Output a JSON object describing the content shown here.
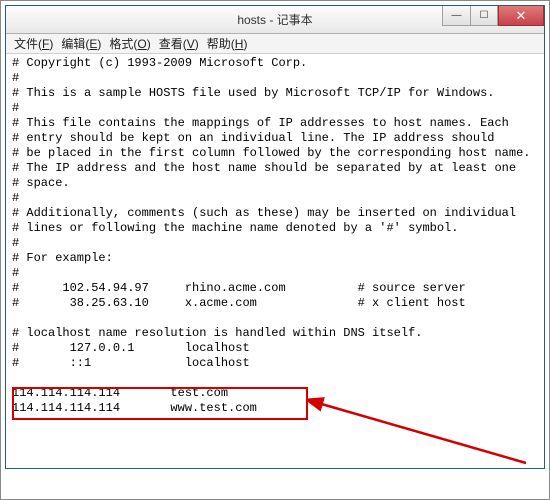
{
  "window": {
    "title": "hosts - 记事本",
    "controls": {
      "min": "—",
      "max": "☐",
      "close": "✕"
    }
  },
  "menu": {
    "file": {
      "label": "文件",
      "key": "F"
    },
    "edit": {
      "label": "编辑",
      "key": "E"
    },
    "format": {
      "label": "格式",
      "key": "O"
    },
    "view": {
      "label": "查看",
      "key": "V"
    },
    "help": {
      "label": "帮助",
      "key": "H"
    }
  },
  "lines": {
    "l0": "# Copyright (c) 1993-2009 Microsoft Corp.",
    "l1": "#",
    "l2": "# This is a sample HOSTS file used by Microsoft TCP/IP for Windows.",
    "l3": "#",
    "l4": "# This file contains the mappings of IP addresses to host names. Each",
    "l5": "# entry should be kept on an individual line. The IP address should",
    "l6": "# be placed in the first column followed by the corresponding host name.",
    "l7": "# The IP address and the host name should be separated by at least one",
    "l8": "# space.",
    "l9": "#",
    "l10": "# Additionally, comments (such as these) may be inserted on individual",
    "l11": "# lines or following the machine name denoted by a '#' symbol.",
    "l12": "#",
    "l13": "# For example:",
    "l14": "#",
    "l15": "#      102.54.94.97     rhino.acme.com          # source server",
    "l16": "#       38.25.63.10     x.acme.com              # x client host",
    "l17": "",
    "l18": "# localhost name resolution is handled within DNS itself.",
    "l19": "#       127.0.0.1       localhost",
    "l20": "#       ::1             localhost",
    "l21": "",
    "l22": "114.114.114.114       test.com",
    "l23": "114.114.114.114       www.test.com"
  }
}
